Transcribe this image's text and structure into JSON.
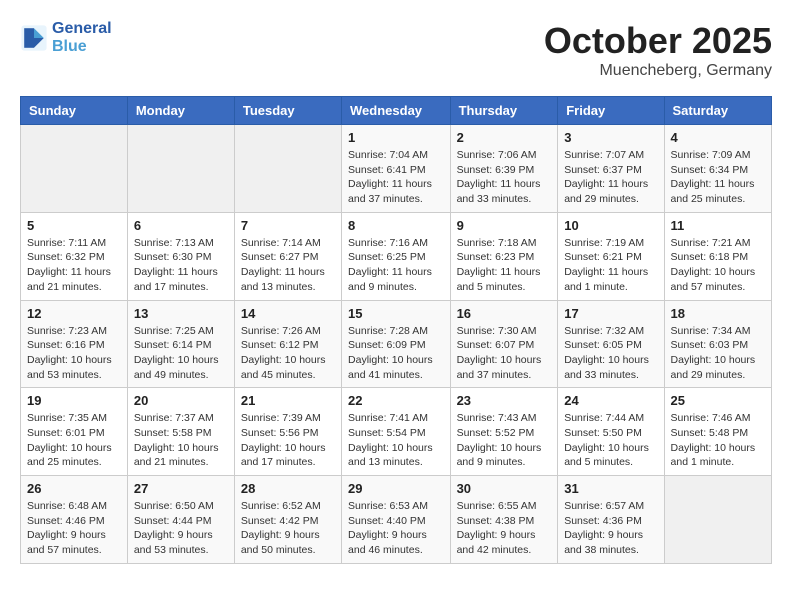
{
  "logo": {
    "line1": "General",
    "line2": "Blue"
  },
  "title": "October 2025",
  "subtitle": "Muencheberg, Germany",
  "weekdays": [
    "Sunday",
    "Monday",
    "Tuesday",
    "Wednesday",
    "Thursday",
    "Friday",
    "Saturday"
  ],
  "weeks": [
    [
      {
        "day": "",
        "info": ""
      },
      {
        "day": "",
        "info": ""
      },
      {
        "day": "",
        "info": ""
      },
      {
        "day": "1",
        "info": "Sunrise: 7:04 AM\nSunset: 6:41 PM\nDaylight: 11 hours and 37 minutes."
      },
      {
        "day": "2",
        "info": "Sunrise: 7:06 AM\nSunset: 6:39 PM\nDaylight: 11 hours and 33 minutes."
      },
      {
        "day": "3",
        "info": "Sunrise: 7:07 AM\nSunset: 6:37 PM\nDaylight: 11 hours and 29 minutes."
      },
      {
        "day": "4",
        "info": "Sunrise: 7:09 AM\nSunset: 6:34 PM\nDaylight: 11 hours and 25 minutes."
      }
    ],
    [
      {
        "day": "5",
        "info": "Sunrise: 7:11 AM\nSunset: 6:32 PM\nDaylight: 11 hours and 21 minutes."
      },
      {
        "day": "6",
        "info": "Sunrise: 7:13 AM\nSunset: 6:30 PM\nDaylight: 11 hours and 17 minutes."
      },
      {
        "day": "7",
        "info": "Sunrise: 7:14 AM\nSunset: 6:27 PM\nDaylight: 11 hours and 13 minutes."
      },
      {
        "day": "8",
        "info": "Sunrise: 7:16 AM\nSunset: 6:25 PM\nDaylight: 11 hours and 9 minutes."
      },
      {
        "day": "9",
        "info": "Sunrise: 7:18 AM\nSunset: 6:23 PM\nDaylight: 11 hours and 5 minutes."
      },
      {
        "day": "10",
        "info": "Sunrise: 7:19 AM\nSunset: 6:21 PM\nDaylight: 11 hours and 1 minute."
      },
      {
        "day": "11",
        "info": "Sunrise: 7:21 AM\nSunset: 6:18 PM\nDaylight: 10 hours and 57 minutes."
      }
    ],
    [
      {
        "day": "12",
        "info": "Sunrise: 7:23 AM\nSunset: 6:16 PM\nDaylight: 10 hours and 53 minutes."
      },
      {
        "day": "13",
        "info": "Sunrise: 7:25 AM\nSunset: 6:14 PM\nDaylight: 10 hours and 49 minutes."
      },
      {
        "day": "14",
        "info": "Sunrise: 7:26 AM\nSunset: 6:12 PM\nDaylight: 10 hours and 45 minutes."
      },
      {
        "day": "15",
        "info": "Sunrise: 7:28 AM\nSunset: 6:09 PM\nDaylight: 10 hours and 41 minutes."
      },
      {
        "day": "16",
        "info": "Sunrise: 7:30 AM\nSunset: 6:07 PM\nDaylight: 10 hours and 37 minutes."
      },
      {
        "day": "17",
        "info": "Sunrise: 7:32 AM\nSunset: 6:05 PM\nDaylight: 10 hours and 33 minutes."
      },
      {
        "day": "18",
        "info": "Sunrise: 7:34 AM\nSunset: 6:03 PM\nDaylight: 10 hours and 29 minutes."
      }
    ],
    [
      {
        "day": "19",
        "info": "Sunrise: 7:35 AM\nSunset: 6:01 PM\nDaylight: 10 hours and 25 minutes."
      },
      {
        "day": "20",
        "info": "Sunrise: 7:37 AM\nSunset: 5:58 PM\nDaylight: 10 hours and 21 minutes."
      },
      {
        "day": "21",
        "info": "Sunrise: 7:39 AM\nSunset: 5:56 PM\nDaylight: 10 hours and 17 minutes."
      },
      {
        "day": "22",
        "info": "Sunrise: 7:41 AM\nSunset: 5:54 PM\nDaylight: 10 hours and 13 minutes."
      },
      {
        "day": "23",
        "info": "Sunrise: 7:43 AM\nSunset: 5:52 PM\nDaylight: 10 hours and 9 minutes."
      },
      {
        "day": "24",
        "info": "Sunrise: 7:44 AM\nSunset: 5:50 PM\nDaylight: 10 hours and 5 minutes."
      },
      {
        "day": "25",
        "info": "Sunrise: 7:46 AM\nSunset: 5:48 PM\nDaylight: 10 hours and 1 minute."
      }
    ],
    [
      {
        "day": "26",
        "info": "Sunrise: 6:48 AM\nSunset: 4:46 PM\nDaylight: 9 hours and 57 minutes."
      },
      {
        "day": "27",
        "info": "Sunrise: 6:50 AM\nSunset: 4:44 PM\nDaylight: 9 hours and 53 minutes."
      },
      {
        "day": "28",
        "info": "Sunrise: 6:52 AM\nSunset: 4:42 PM\nDaylight: 9 hours and 50 minutes."
      },
      {
        "day": "29",
        "info": "Sunrise: 6:53 AM\nSunset: 4:40 PM\nDaylight: 9 hours and 46 minutes."
      },
      {
        "day": "30",
        "info": "Sunrise: 6:55 AM\nSunset: 4:38 PM\nDaylight: 9 hours and 42 minutes."
      },
      {
        "day": "31",
        "info": "Sunrise: 6:57 AM\nSunset: 4:36 PM\nDaylight: 9 hours and 38 minutes."
      },
      {
        "day": "",
        "info": ""
      }
    ]
  ]
}
